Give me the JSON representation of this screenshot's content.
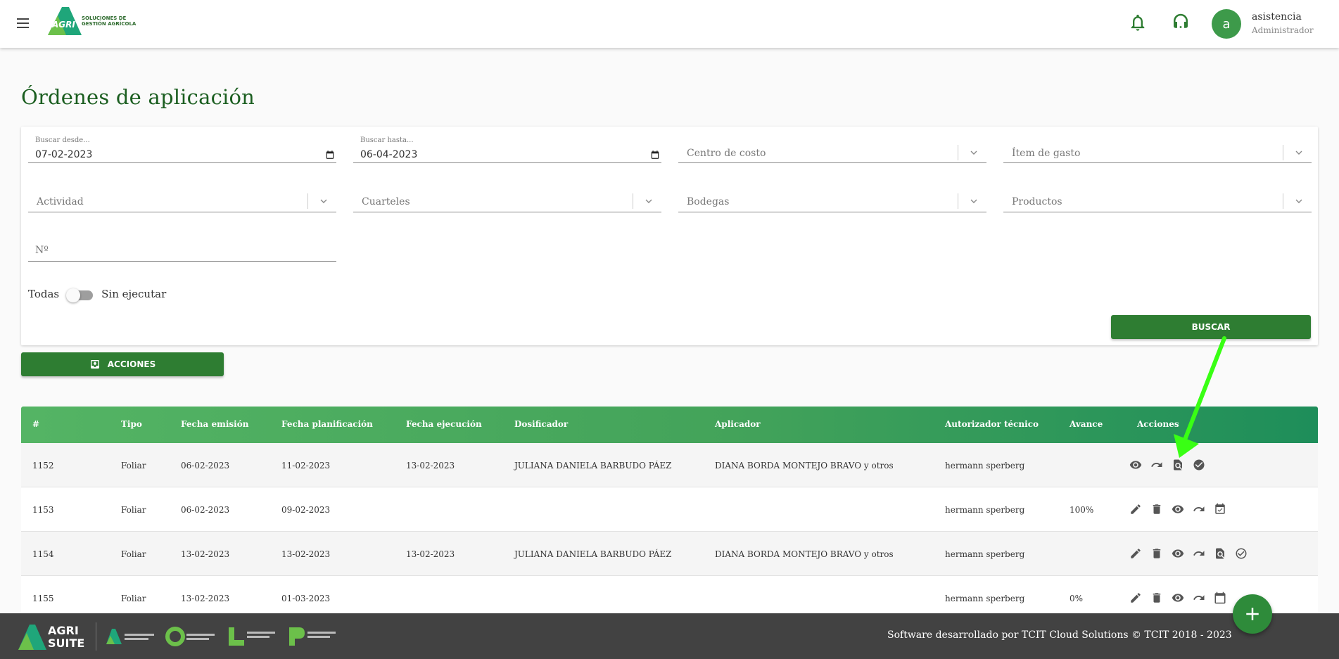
{
  "header": {
    "logo_text_line1": "SOLUCIONES DE",
    "logo_text_line2": "GESTIÓN AGRÍCOLA",
    "logo_brand": "AGRI",
    "user_initial": "a",
    "user_name": "asistencia",
    "user_role": "Administrador",
    "icons": [
      "menu-icon",
      "bell-icon",
      "headset-icon"
    ]
  },
  "page": {
    "title": "Órdenes de aplicación"
  },
  "filters": {
    "desde_label": "Buscar desde...",
    "desde_value": "07-02-2023",
    "hasta_label": "Buscar hasta...",
    "hasta_value": "06-04-2023",
    "centro_costo": "Centro de costo",
    "item_gasto": "Ítem de gasto",
    "actividad": "Actividad",
    "cuarteles": "Cuarteles",
    "bodegas": "Bodegas",
    "productos": "Productos",
    "numero": "Nº",
    "toggle_left": "Todas",
    "toggle_right": "Sin ejecutar",
    "buscar_label": "BUSCAR"
  },
  "acciones_label": "ACCIONES",
  "table": {
    "headers": [
      "#",
      "Tipo",
      "Fecha emisión",
      "Fecha planificación",
      "Fecha ejecución",
      "Dosificador",
      "Aplicador",
      "Autorizador técnico",
      "Avance",
      "Acciones"
    ],
    "rows": [
      {
        "num": "1152",
        "tipo": "Foliar",
        "emision": "06-02-2023",
        "planificacion": "11-02-2023",
        "ejecucion": "13-02-2023",
        "dosificador": "JULIANA DANIELA BARBUDO PÁEZ",
        "aplicador": "DIANA BORDA MONTEJO BRAVO y otros",
        "autorizador": "hermann sperberg",
        "avance": "",
        "actions": [
          "view",
          "forward",
          "search-doc",
          "check-filled"
        ]
      },
      {
        "num": "1153",
        "tipo": "Foliar",
        "emision": "06-02-2023",
        "planificacion": "09-02-2023",
        "ejecucion": "",
        "dosificador": "",
        "aplicador": "",
        "autorizador": "hermann sperberg",
        "avance": "100%",
        "actions": [
          "edit",
          "delete",
          "view",
          "forward",
          "calendar-check"
        ]
      },
      {
        "num": "1154",
        "tipo": "Foliar",
        "emision": "13-02-2023",
        "planificacion": "13-02-2023",
        "ejecucion": "13-02-2023",
        "dosificador": "JULIANA DANIELA BARBUDO PÁEZ",
        "aplicador": "DIANA BORDA MONTEJO BRAVO y otros",
        "autorizador": "hermann sperberg",
        "avance": "",
        "actions": [
          "edit",
          "delete",
          "view",
          "forward",
          "search-doc",
          "check-outline"
        ]
      },
      {
        "num": "1155",
        "tipo": "Foliar",
        "emision": "13-02-2023",
        "planificacion": "01-03-2023",
        "ejecucion": "",
        "dosificador": "",
        "aplicador": "",
        "autorizador": "hermann sperberg",
        "avance": "0%",
        "actions": [
          "edit",
          "delete",
          "view",
          "forward",
          "calendar"
        ]
      }
    ]
  },
  "footer": {
    "brand_line1": "AGRI",
    "brand_line2": "SUITE",
    "text": "Software desarrollado por TCIT Cloud Solutions © TCIT 2018 - 2023"
  },
  "colors": {
    "primary": "#2e7d32",
    "title": "#1b5e20",
    "header_gradient_end": "#1e8e5a",
    "footer": "#424242",
    "annotation_arrow": "#39ff14"
  }
}
